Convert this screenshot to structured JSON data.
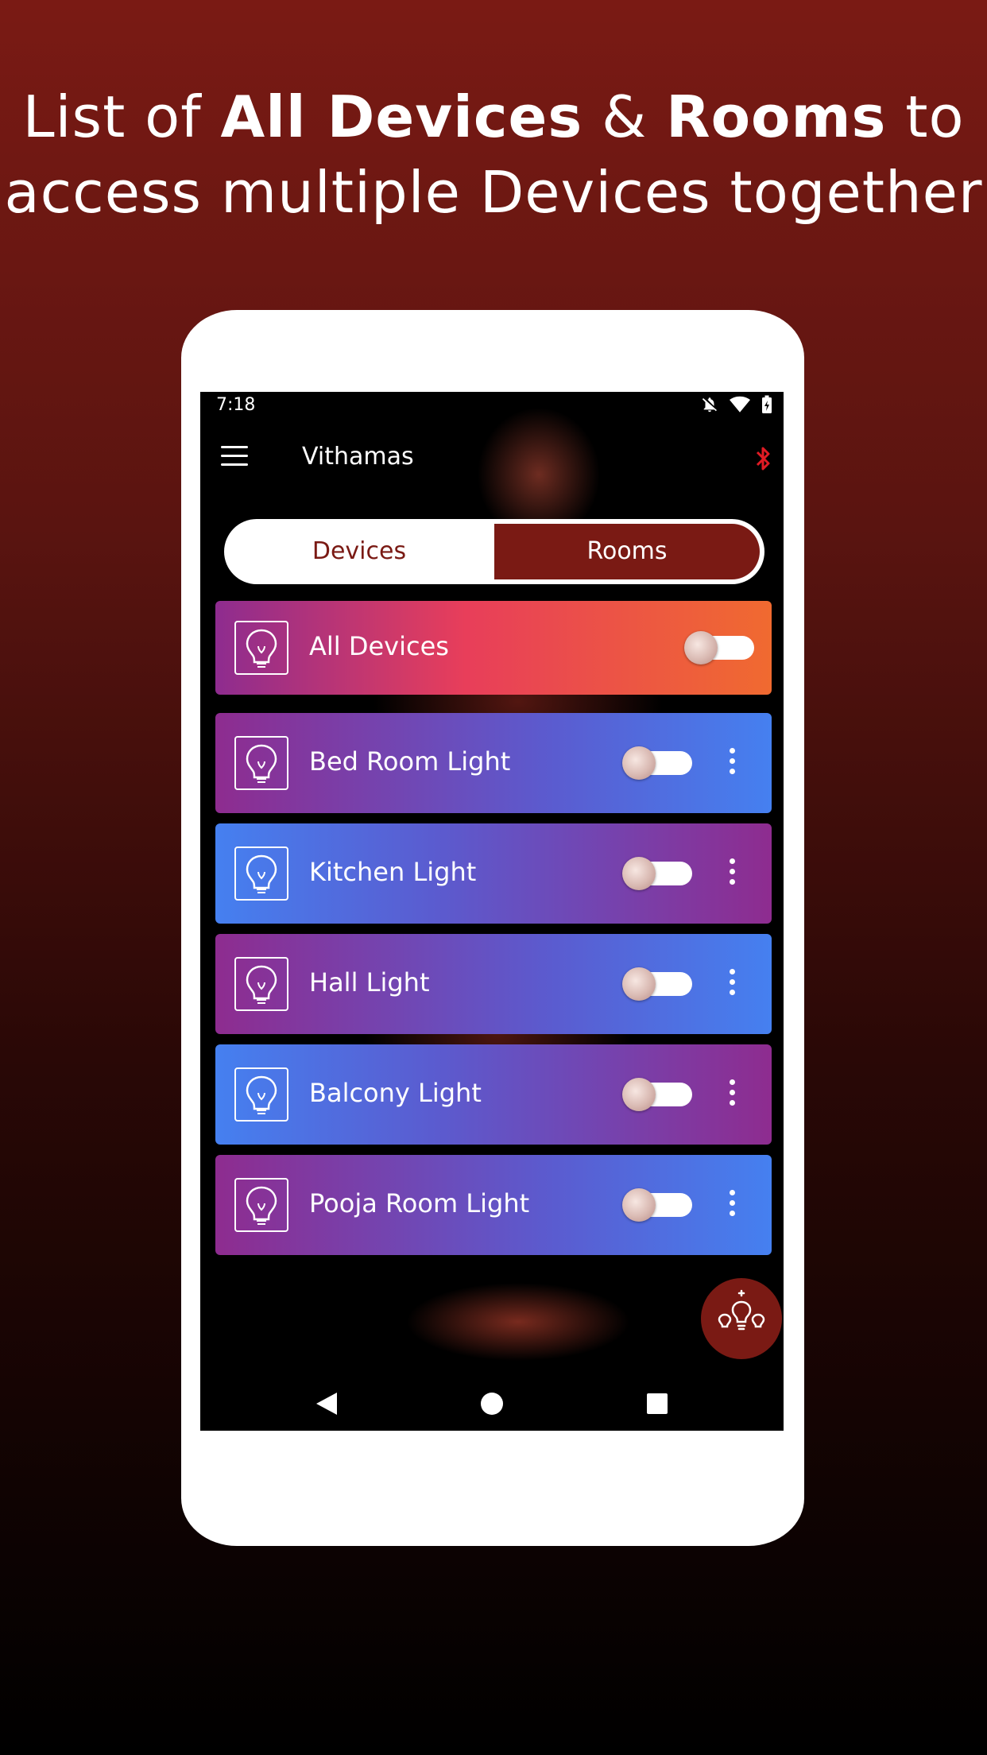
{
  "headline": {
    "part1": "List of ",
    "bold1": "All Devices",
    "part2": " & ",
    "bold2": "Rooms",
    "part3": " to",
    "line2": "access multiple Devices together"
  },
  "status_bar": {
    "time": "7:18",
    "icons": [
      "notifications-off-icon",
      "wifi-icon",
      "battery-charging-icon"
    ]
  },
  "app_bar": {
    "title": "Vithamas",
    "left_icon": "menu-icon",
    "right_icon": "bluetooth-icon",
    "bluetooth_color": "#e01b24"
  },
  "tabs": [
    {
      "label": "Devices",
      "selected": false
    },
    {
      "label": "Rooms",
      "selected": true
    }
  ],
  "all_devices": {
    "label": "All Devices",
    "on": false
  },
  "devices": [
    {
      "label": "Bed Room Light",
      "on": false
    },
    {
      "label": "Kitchen Light",
      "on": false
    },
    {
      "label": "Hall Light",
      "on": false
    },
    {
      "label": "Balcony Light",
      "on": false
    },
    {
      "label": "Pooja Room Light",
      "on": false
    }
  ],
  "fab": {
    "icon": "add-lights-icon"
  },
  "colors": {
    "accent": "#7a1a14",
    "card_purple": "#8e2c8f",
    "card_blue": "#4580f0",
    "all_orange": "#f06a30"
  }
}
